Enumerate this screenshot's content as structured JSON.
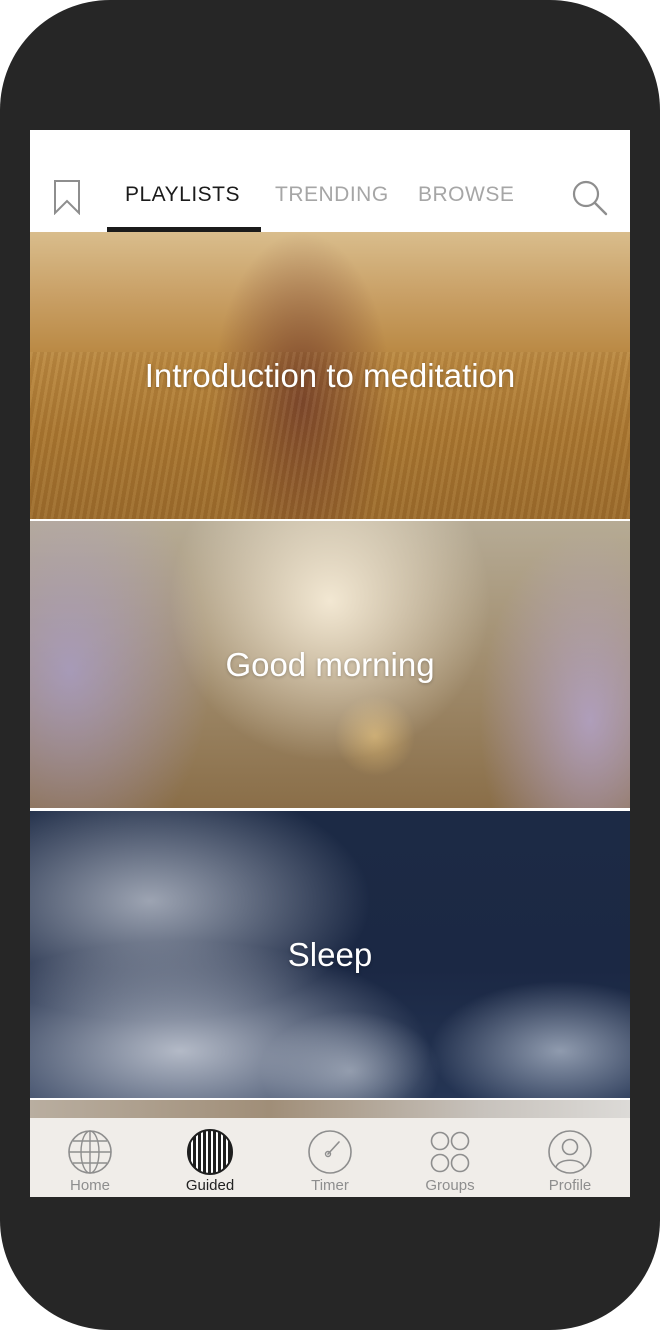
{
  "top_nav": {
    "tabs": [
      {
        "label": "PLAYLISTS",
        "active": true
      },
      {
        "label": "TRENDING",
        "active": false
      },
      {
        "label": "BROWSE",
        "active": false
      }
    ],
    "left_icon": "bookmark-icon",
    "right_icon": "search-icon"
  },
  "playlists": [
    {
      "title": "Introduction to meditation"
    },
    {
      "title": "Good morning"
    },
    {
      "title": "Sleep"
    }
  ],
  "bottom_nav": {
    "items": [
      {
        "label": "Home",
        "icon": "globe-icon",
        "active": false
      },
      {
        "label": "Guided",
        "icon": "guided-icon",
        "active": true
      },
      {
        "label": "Timer",
        "icon": "timer-icon",
        "active": false
      },
      {
        "label": "Groups",
        "icon": "groups-icon",
        "active": false
      },
      {
        "label": "Profile",
        "icon": "profile-icon",
        "active": false
      }
    ]
  },
  "colors": {
    "device_frame": "#262626",
    "active_text": "#1b1b1b",
    "inactive_text": "#a6a6a6",
    "tab_bar_background": "#f0ede9"
  }
}
